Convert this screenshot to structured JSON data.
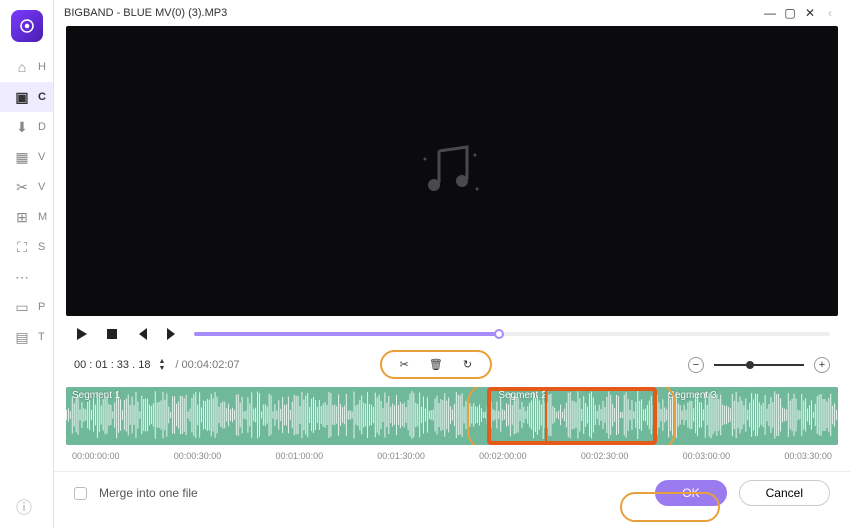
{
  "titlebar": {
    "title": "BIGBAND - BLUE MV(0) (3).MP3"
  },
  "sidebar": {
    "items": [
      {
        "glyph": "⌂",
        "label": "H"
      },
      {
        "glyph": "▣",
        "label": "C",
        "active": true
      },
      {
        "glyph": "⬇",
        "label": "D"
      },
      {
        "glyph": "▦",
        "label": "V"
      },
      {
        "glyph": "✂",
        "label": "V"
      },
      {
        "glyph": "⊞",
        "label": "M"
      },
      {
        "glyph": "⛶",
        "label": "S"
      },
      {
        "glyph": "⋯",
        "label": ""
      },
      {
        "glyph": "▭",
        "label": "P"
      },
      {
        "glyph": "▤",
        "label": "T"
      }
    ]
  },
  "time": {
    "current": "00 : 01 : 33 . 18",
    "total": "/ 00:04:02:07"
  },
  "segments": {
    "s1": "Segment 1",
    "s2": "Segment 2",
    "s3": "Segment 3"
  },
  "ruler": {
    "ticks": [
      "00:00:00:00",
      "00:00:30:00",
      "00:01:00:00",
      "00:01:30:00",
      "00:02:00:00",
      "00:02:30:00",
      "00:03:00:00",
      "00:03:30:00"
    ]
  },
  "footer": {
    "merge_label": "Merge into one file",
    "ok_label": "OK",
    "cancel_label": "Cancel"
  }
}
